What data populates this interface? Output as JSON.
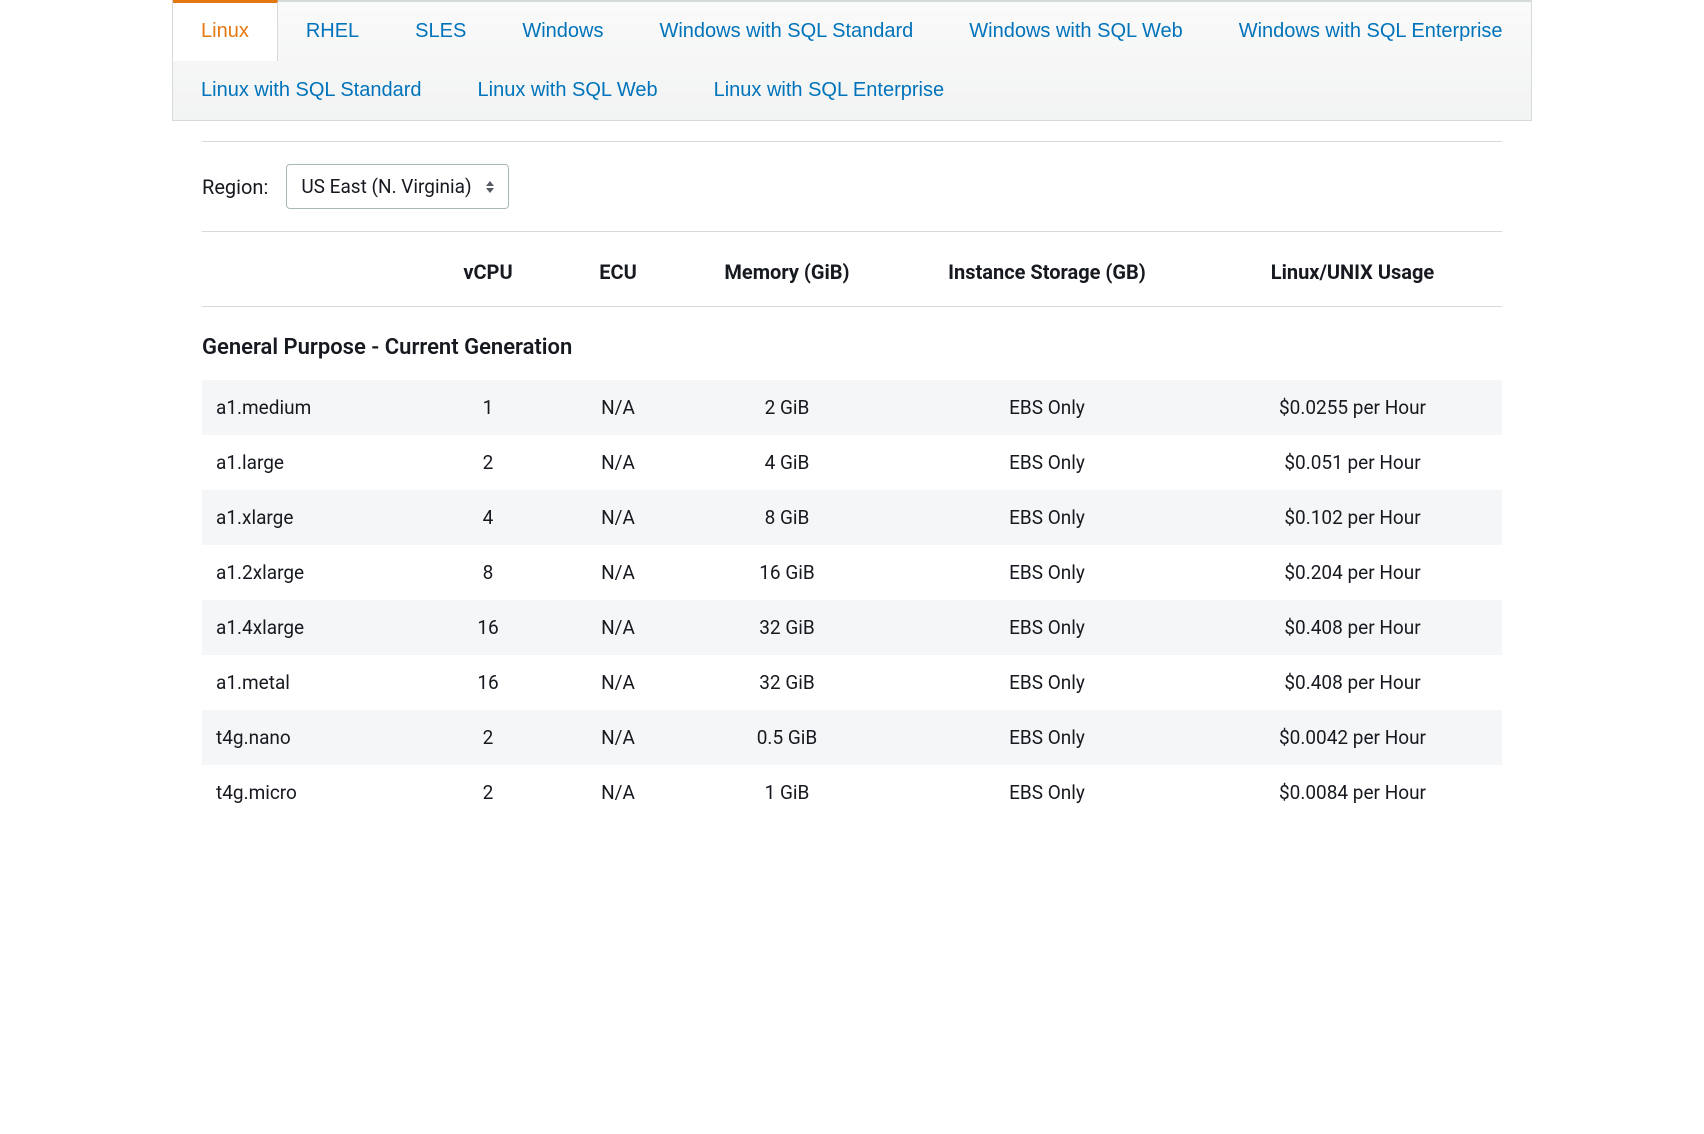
{
  "tabs": [
    {
      "label": "Linux",
      "active": true
    },
    {
      "label": "RHEL",
      "active": false
    },
    {
      "label": "SLES",
      "active": false
    },
    {
      "label": "Windows",
      "active": false
    },
    {
      "label": "Windows with SQL Standard",
      "active": false
    },
    {
      "label": "Windows with SQL Web",
      "active": false
    },
    {
      "label": "Windows with SQL Enterprise",
      "active": false
    },
    {
      "label": "Linux with SQL Standard",
      "active": false
    },
    {
      "label": "Linux with SQL Web",
      "active": false
    },
    {
      "label": "Linux with SQL Enterprise",
      "active": false
    }
  ],
  "region": {
    "label": "Region:",
    "selected": "US East (N. Virginia)"
  },
  "table": {
    "headers": [
      "",
      "vCPU",
      "ECU",
      "Memory (GiB)",
      "Instance Storage (GB)",
      "Linux/UNIX Usage"
    ],
    "section_title": "General Purpose - Current Generation",
    "rows": [
      {
        "name": "a1.medium",
        "vcpu": "1",
        "ecu": "N/A",
        "memory": "2 GiB",
        "storage": "EBS Only",
        "usage": "$0.0255 per Hour"
      },
      {
        "name": "a1.large",
        "vcpu": "2",
        "ecu": "N/A",
        "memory": "4 GiB",
        "storage": "EBS Only",
        "usage": "$0.051 per Hour"
      },
      {
        "name": "a1.xlarge",
        "vcpu": "4",
        "ecu": "N/A",
        "memory": "8 GiB",
        "storage": "EBS Only",
        "usage": "$0.102 per Hour"
      },
      {
        "name": "a1.2xlarge",
        "vcpu": "8",
        "ecu": "N/A",
        "memory": "16 GiB",
        "storage": "EBS Only",
        "usage": "$0.204 per Hour"
      },
      {
        "name": "a1.4xlarge",
        "vcpu": "16",
        "ecu": "N/A",
        "memory": "32 GiB",
        "storage": "EBS Only",
        "usage": "$0.408 per Hour"
      },
      {
        "name": "a1.metal",
        "vcpu": "16",
        "ecu": "N/A",
        "memory": "32 GiB",
        "storage": "EBS Only",
        "usage": "$0.408 per Hour"
      },
      {
        "name": "t4g.nano",
        "vcpu": "2",
        "ecu": "N/A",
        "memory": "0.5 GiB",
        "storage": "EBS Only",
        "usage": "$0.0042 per Hour"
      },
      {
        "name": "t4g.micro",
        "vcpu": "2",
        "ecu": "N/A",
        "memory": "1 GiB",
        "storage": "EBS Only",
        "usage": "$0.0084 per Hour"
      }
    ]
  }
}
